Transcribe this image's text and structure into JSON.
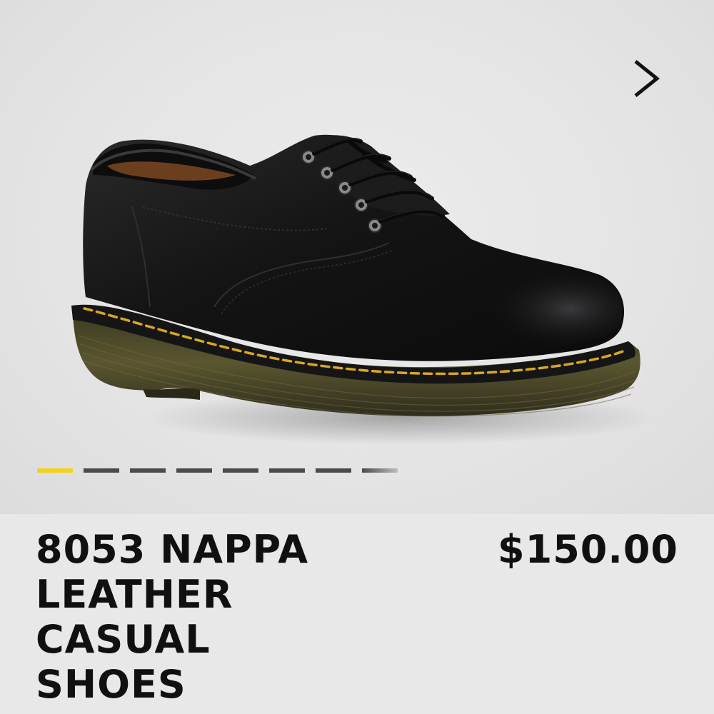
{
  "gallery": {
    "image_alt": "Black leather casual shoe",
    "next_icon": "chevron-right-icon",
    "pager": {
      "total": 8,
      "active_index": 0,
      "active_color": "#f2d21b",
      "inactive_color": "#4b4b4e"
    }
  },
  "product": {
    "title_lines": [
      "8053 NAPPA",
      "LEATHER",
      "CASUAL",
      "SHOES"
    ],
    "price": "$150.00"
  }
}
